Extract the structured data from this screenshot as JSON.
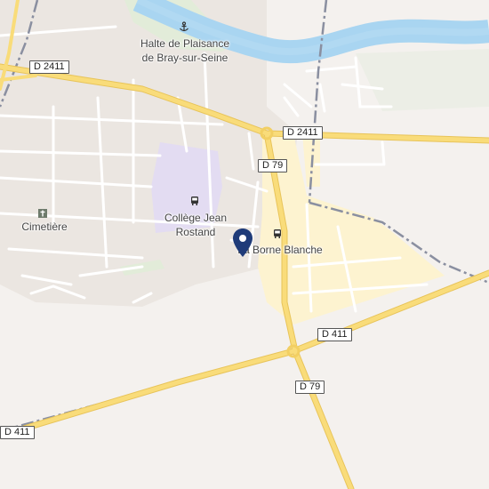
{
  "map": {
    "colors": {
      "background": "#f4f1ee",
      "town": "#ebe6e1",
      "water": "#a9d5f1",
      "industrial": "#fdf3d0",
      "school": "#e3dcf2",
      "park": "#e2ecd9",
      "major_road": "#f7d56d",
      "minor_road": "#ffffff",
      "boundary": "#8a8fa0",
      "pin": "#1f3b79"
    },
    "places": {
      "halte_line1": "Halte de Plaisance",
      "halte_line2": "de Bray-sur-Seine",
      "college_line1": "Collège Jean",
      "college_line2": "Rostand",
      "cimetiere": "Cimetière",
      "borne_blanche": "La Borne Blanche"
    },
    "roads": {
      "d2411_west": "D 2411",
      "d2411_east": "D 2411",
      "d79_north": "D 79",
      "d411_east": "D 411",
      "d79_south": "D 79",
      "d411_west": "D 411"
    },
    "icons": [
      "anchor-icon",
      "bus-icon",
      "bus-icon",
      "cemetery-icon",
      "location-pin-icon"
    ]
  }
}
